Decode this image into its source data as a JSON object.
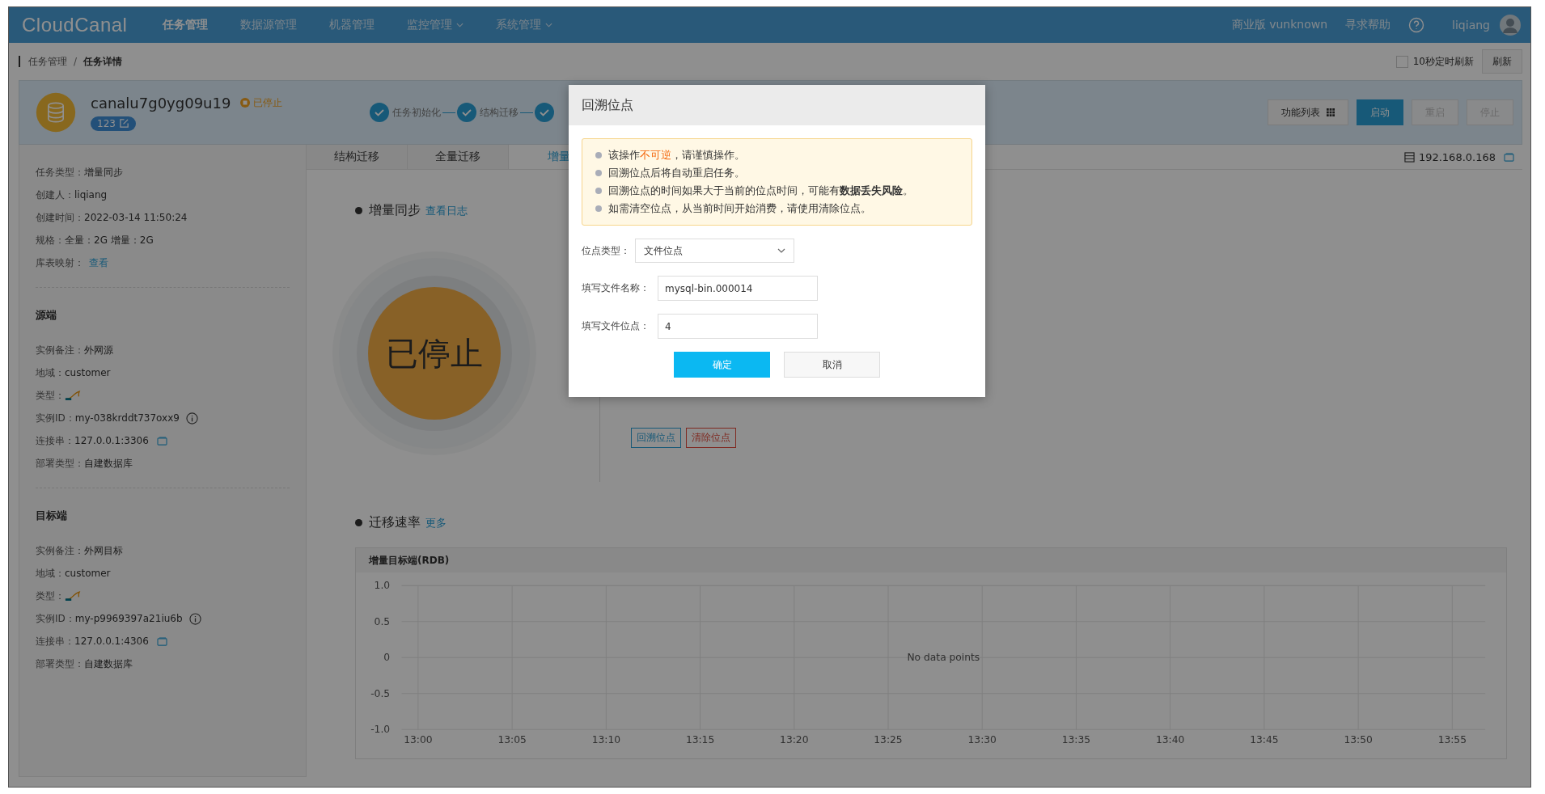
{
  "nav": {
    "logo": "CloudCanal",
    "items": [
      {
        "label": "任务管理",
        "selected": true,
        "dropdown": false
      },
      {
        "label": "数据源管理",
        "selected": false,
        "dropdown": false
      },
      {
        "label": "机器管理",
        "selected": false,
        "dropdown": false
      },
      {
        "label": "监控管理",
        "selected": false,
        "dropdown": true
      },
      {
        "label": "系统管理",
        "selected": false,
        "dropdown": true
      }
    ],
    "edition": "商业版 vunknown",
    "help": "寻求帮助",
    "user": "liqiang"
  },
  "breadcrumb": [
    "任务管理",
    "任务详情"
  ],
  "breadcrumb_separator": "/",
  "auto_refresh": {
    "label": "10秒定时刷新",
    "checked": false
  },
  "refresh_button": "刷新",
  "task": {
    "name": "canalu7g0yg09u19",
    "status": "已停止",
    "tag": "123",
    "steps": [
      {
        "label": "任务初始化",
        "done": true
      },
      {
        "label": "结构迁移",
        "done": true
      },
      {
        "done": true
      }
    ],
    "buttons": [
      {
        "label": "功能列表",
        "kind": "menu",
        "disabled": false
      },
      {
        "label": "启动",
        "kind": "primary",
        "disabled": false
      },
      {
        "label": "重启",
        "kind": "plain",
        "disabled": true
      },
      {
        "label": "停止",
        "kind": "plain",
        "disabled": true
      }
    ]
  },
  "sidebar": {
    "sections": [
      {
        "rows": [
          {
            "label": "任务类型：",
            "value": "增量同步",
            "kind": "text"
          },
          {
            "label": "创建人：",
            "value": "liqiang",
            "kind": "text"
          },
          {
            "label": "创建时间：",
            "value": "2022-03-14 11:50:24",
            "kind": "text"
          },
          {
            "label": "规格：",
            "value": "全量：2G 增量：2G",
            "kind": "text"
          },
          {
            "label": "库表映射：",
            "value": "查看",
            "kind": "link"
          }
        ]
      },
      {
        "title": "源端",
        "rows": [
          {
            "label": "实例备注：",
            "value": "外网源",
            "kind": "text"
          },
          {
            "label": "地域：",
            "value": "customer",
            "kind": "text"
          },
          {
            "label": "类型：",
            "kind": "logo"
          },
          {
            "label": "实例ID：",
            "value": "my-038krddt737oxx9",
            "kind": "info"
          },
          {
            "label": "连接串：",
            "value": "127.0.0.1:3306",
            "kind": "copy"
          },
          {
            "label": "部署类型：",
            "value": "自建数据库",
            "kind": "text"
          }
        ]
      },
      {
        "title": "目标端",
        "rows": [
          {
            "label": "实例备注：",
            "value": "外网目标",
            "kind": "text"
          },
          {
            "label": "地域：",
            "value": "customer",
            "kind": "text"
          },
          {
            "label": "类型：",
            "kind": "logo"
          },
          {
            "label": "实例ID：",
            "value": "my-p9969397a21iu6b",
            "kind": "info"
          },
          {
            "label": "连接串：",
            "value": "127.0.0.1:4306",
            "kind": "copy"
          },
          {
            "label": "部署类型：",
            "value": "自建数据库",
            "kind": "text"
          }
        ]
      }
    ]
  },
  "tabs": [
    {
      "label": "结构迁移",
      "selected": false
    },
    {
      "label": "全量迁移",
      "selected": false
    },
    {
      "label": "增量",
      "selected": true
    }
  ],
  "host": "192.168.0.168",
  "sync": {
    "title": "增量同步",
    "link": "查看日志",
    "state": "已停止",
    "buttons": [
      {
        "label": "回溯位点",
        "kind": "primary"
      },
      {
        "label": "清除位点",
        "kind": "danger"
      }
    ]
  },
  "rate": {
    "title": "迁移速率",
    "link": "更多",
    "chart_data": {
      "type": "line",
      "grid": true,
      "title": "增量目标端(RDB)",
      "categories": [
        "13:00",
        "13:05",
        "13:10",
        "13:15",
        "13:20",
        "13:25",
        "13:30",
        "13:35",
        "13:40",
        "13:45",
        "13:50",
        "13:55"
      ],
      "ylim": [
        -1,
        1
      ],
      "yticks": [
        {
          "value": 1,
          "label": "1.0"
        },
        0.5,
        0,
        -0.5,
        {
          "value": -1,
          "label": "-1.0"
        }
      ],
      "annotations": [
        "No data points"
      ]
    }
  },
  "modal": {
    "title": "回溯位点",
    "warnings": [
      [
        {
          "text": "该操作",
          "kind": "text"
        },
        {
          "text": "不可逆",
          "kind": "warning"
        },
        {
          "text": "，请谨慎操作。",
          "kind": "text"
        }
      ],
      [
        {
          "text": "回溯位点后将自动重启任务。",
          "kind": "text"
        }
      ],
      [
        {
          "text": "回溯位点的时间如果大于当前的位点时间，可能有",
          "kind": "text"
        },
        {
          "text": "数据丢失风险",
          "kind": "strong"
        },
        {
          "text": "。",
          "kind": "text"
        }
      ],
      [
        {
          "text": "如需清空位点，从当前时间开始消费，请使用清除位点。",
          "kind": "text"
        }
      ]
    ],
    "fields": [
      {
        "label": "位点类型：",
        "kind": "select",
        "value": "文件位点"
      },
      {
        "label": "填写文件名称：",
        "kind": "input",
        "value": "mysql-bin.000014"
      },
      {
        "label": "填写文件位点：",
        "kind": "input",
        "value": "4"
      }
    ],
    "buttons": [
      {
        "label": "确定",
        "kind": "primary"
      },
      {
        "label": "取消",
        "kind": "plain"
      }
    ]
  }
}
